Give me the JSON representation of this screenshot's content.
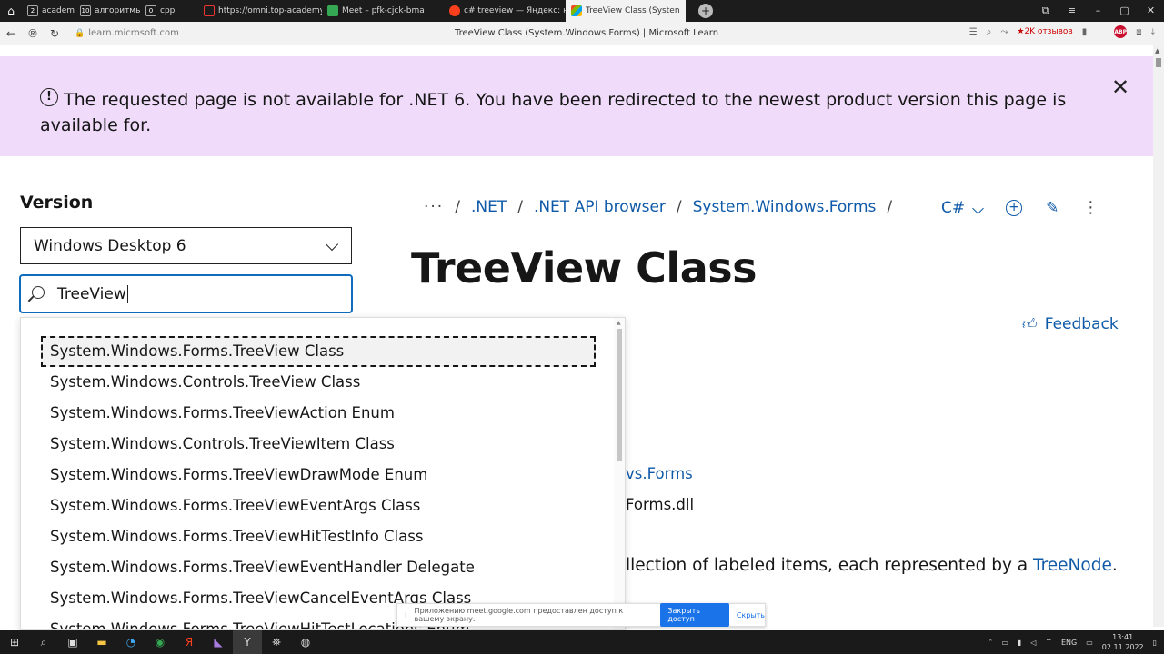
{
  "browser": {
    "tabs": [
      {
        "label": "academy",
        "icon": "2"
      },
      {
        "label": "алгоритмы",
        "icon": "10"
      },
      {
        "label": "cpp",
        "icon": "0"
      },
      {
        "label": "https://omni.top-academy",
        "icon": ""
      },
      {
        "label": "Meet – pfk-cjck-bma",
        "icon": ""
      },
      {
        "label": "c# treeview — Яндекс: на",
        "icon": ""
      },
      {
        "label": "TreeView Class (Systen",
        "icon": ""
      }
    ],
    "url_host": "learn.microsoft.com",
    "page_title": "TreeView Class (System.Windows.Forms) | Microsoft Learn",
    "rating": "★2K отзывов"
  },
  "banner": {
    "text": "The requested page is not available for .NET 6. You have been redirected to the newest product version this page is available for."
  },
  "sidebar": {
    "version_label": "Version",
    "version_value": "Windows Desktop 6",
    "search_value": "TreeView",
    "results": [
      "System.Windows.Forms.TreeView Class",
      "System.Windows.Controls.TreeView Class",
      "System.Windows.Forms.TreeViewAction Enum",
      "System.Windows.Controls.TreeViewItem Class",
      "System.Windows.Forms.TreeViewDrawMode Enum",
      "System.Windows.Forms.TreeViewEventArgs Class",
      "System.Windows.Forms.TreeViewHitTestInfo Class",
      "System.Windows.Forms.TreeViewEventHandler Delegate",
      "System.Windows.Forms.TreeViewCancelEventArgs Class",
      "System.Windows.Forms.TreeViewHitTestLocations Enum"
    ]
  },
  "main": {
    "breadcrumb": {
      "more": "···",
      "items": [
        ".NET",
        ".NET API browser",
        "System.Windows.Forms"
      ]
    },
    "language": "C#",
    "title": "TreeView Class",
    "feedback": "Feedback",
    "namespace_fragment": "vs.Forms",
    "assembly_fragment": "Forms.dll",
    "description_fragment": "llection of labeled items, each represented by a ",
    "description_link": "TreeNode",
    "description_end": "."
  },
  "share_bar": {
    "text": "Приложению meet.google.com предоставлен доступ к вашему экрану.",
    "stop": "Закрыть доступ",
    "hide": "Скрыть"
  },
  "taskbar": {
    "lang": "ENG",
    "time": "13:41",
    "date": "02.11.2022"
  }
}
